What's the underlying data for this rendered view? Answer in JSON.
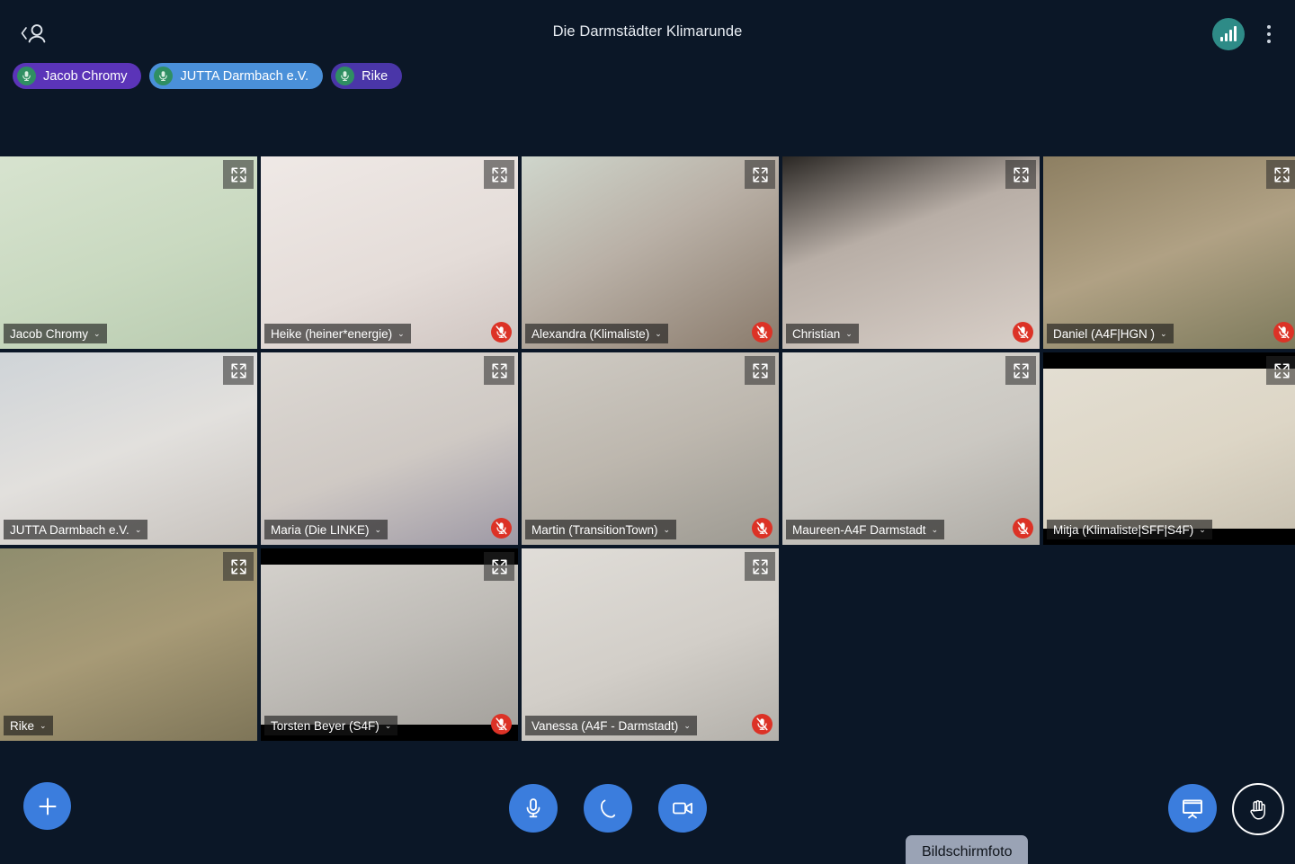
{
  "header": {
    "title": "Die Darmstädter Klimarunde",
    "participants_icon": "back-person-icon",
    "signal_icon": "signal-strength-icon",
    "menu_icon": "kebab-menu-icon"
  },
  "active_speakers": [
    {
      "name": "Jacob Chromy",
      "color": "#5b34b8",
      "icon": "microphone-icon"
    },
    {
      "name": "JUTTA Darmbach e.V.",
      "color": "#4a90d9",
      "icon": "microphone-icon"
    },
    {
      "name": "Rike",
      "color": "#4a36a8",
      "icon": "microphone-icon"
    }
  ],
  "grid": {
    "rows": [
      [
        {
          "name": "Jacob Chromy",
          "muted": false,
          "speaking": true,
          "letterbox": false,
          "bg": "linear-gradient(160deg,#d7e3cf 0%,#c9d9c0 55%,#b9cbb0 100%)"
        },
        {
          "name": "Heike (heiner*energie)",
          "muted": true,
          "speaking": false,
          "letterbox": false,
          "bg": "linear-gradient(160deg,#efe9e6 0%,#e4dcd8 60%,#cfc5c1 100%)"
        },
        {
          "name": "Alexandra (Klimaliste)",
          "muted": true,
          "speaking": false,
          "letterbox": false,
          "bg": "linear-gradient(150deg,#cfd6cc 0%,#b9b0a6 45%,#8a7b6c 100%)"
        },
        {
          "name": "Christian",
          "muted": true,
          "speaking": false,
          "letterbox": false,
          "bg": "linear-gradient(160deg,#2a2724 0%,#b8aea6 40%,#d8cfc8 100%)"
        },
        {
          "name": "Daniel (A4F|HGN )",
          "muted": true,
          "speaking": false,
          "letterbox": false,
          "bg": "linear-gradient(160deg,#8d7f62 0%,#b0a184 50%,#7d7a5c 100%)"
        }
      ],
      [
        {
          "name": "JUTTA Darmbach e.V.",
          "muted": false,
          "speaking": true,
          "letterbox": false,
          "bg": "linear-gradient(160deg,#cfd4d8 0%,#e2e0dd 50%,#c7c2bd 100%)"
        },
        {
          "name": "Maria (Die LINKE)",
          "muted": true,
          "speaking": false,
          "letterbox": false,
          "bg": "linear-gradient(160deg,#ddd9d4 0%,#cfc9c4 55%,#9e99a5 100%)"
        },
        {
          "name": "Martin (TransitionTown)",
          "muted": true,
          "speaking": false,
          "letterbox": false,
          "bg": "linear-gradient(160deg,#cfcbc4 0%,#bdb7ae 50%,#9d9a92 100%)"
        },
        {
          "name": "Maureen-A4F Darmstadt",
          "muted": true,
          "speaking": false,
          "letterbox": false,
          "bg": "linear-gradient(160deg,#d8d6d0 0%,#cbc8c2 55%,#aeaba5 100%)"
        },
        {
          "name": "Mitja (Klimaliste|SFF|S4F)",
          "muted": false,
          "speaking": false,
          "letterbox": true,
          "bg": "linear-gradient(160deg,#e3ded2 0%,#ddd6c6 55%,#c9c2b2 100%)"
        }
      ],
      [
        {
          "name": "Rike",
          "muted": false,
          "speaking": true,
          "letterbox": false,
          "bg": "linear-gradient(160deg,#8f8d6e 0%,#a79a76 50%,#7e7558 100%)"
        },
        {
          "name": "Torsten Beyer (S4F)",
          "muted": true,
          "speaking": false,
          "letterbox": true,
          "bg": "linear-gradient(160deg,#d3d0cb 0%,#bfbcb7 50%,#a5a29d 100%)"
        },
        {
          "name": "Vanessa (A4F - Darmstadt)",
          "muted": true,
          "speaking": false,
          "letterbox": false,
          "bg": "linear-gradient(160deg,#e0ddd8 0%,#d2cec8 55%,#b3b0aa 100%)"
        }
      ]
    ],
    "expand_icon": "expand-icon",
    "mute_icon": "microphone-muted-icon",
    "chevron": "⌄"
  },
  "toolbar": {
    "add_label": "add-button",
    "mic_label": "microphone-button",
    "hangup_label": "hangup-button",
    "camera_label": "camera-button",
    "present_label": "present-screen-button",
    "raisehand_label": "raise-hand-button",
    "screenshot_toast": "Bildschirmfoto"
  }
}
